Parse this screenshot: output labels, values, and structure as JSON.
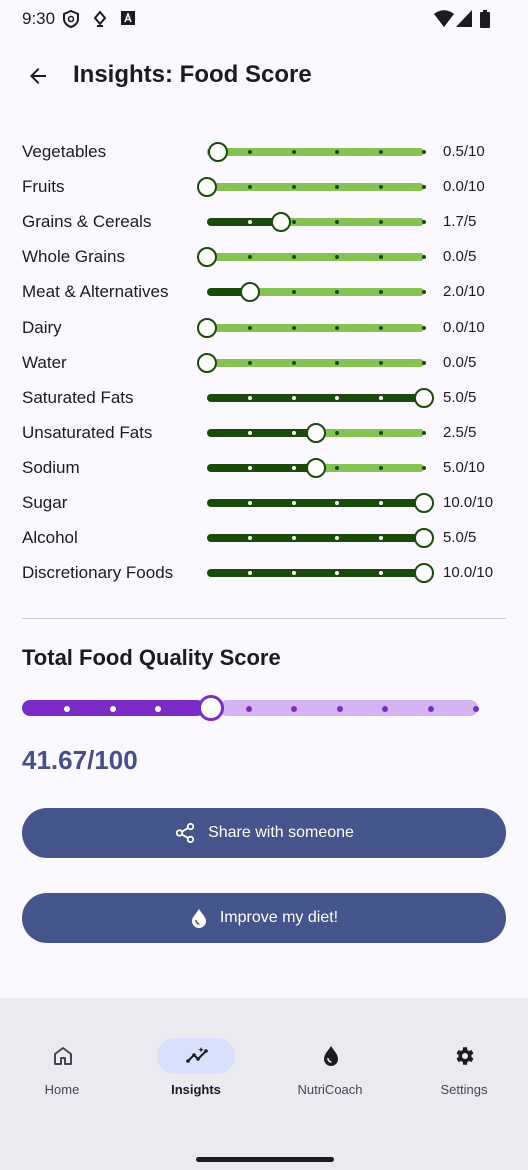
{
  "status_bar": {
    "time": "9:30"
  },
  "header": {
    "title": "Insights: Food Score"
  },
  "categories": [
    {
      "label": "Vegetables",
      "value": 0.5,
      "max": 10,
      "value_text": "0.5/10",
      "fill_style": "inverse"
    },
    {
      "label": "Fruits",
      "value": 0.0,
      "max": 10,
      "value_text": "0.0/10",
      "fill_style": "inverse"
    },
    {
      "label": "Grains & Cereals",
      "value": 1.7,
      "max": 5,
      "value_text": "1.7/5",
      "fill_style": "normal"
    },
    {
      "label": "Whole Grains",
      "value": 0.0,
      "max": 5,
      "value_text": "0.0/5",
      "fill_style": "normal"
    },
    {
      "label": "Meat & Alternatives",
      "value": 2.0,
      "max": 10,
      "value_text": "2.0/10",
      "fill_style": "normal"
    },
    {
      "label": "Dairy",
      "value": 0.0,
      "max": 10,
      "value_text": "0.0/10",
      "fill_style": "normal"
    },
    {
      "label": "Water",
      "value": 0.0,
      "max": 5,
      "value_text": "0.0/5",
      "fill_style": "normal"
    },
    {
      "label": "Saturated Fats",
      "value": 5.0,
      "max": 5,
      "value_text": "5.0/5",
      "fill_style": "normal"
    },
    {
      "label": "Unsaturated Fats",
      "value": 2.5,
      "max": 5,
      "value_text": "2.5/5",
      "fill_style": "normal"
    },
    {
      "label": "Sodium",
      "value": 5.0,
      "max": 10,
      "value_text": "5.0/10",
      "fill_style": "normal"
    },
    {
      "label": "Sugar",
      "value": 10.0,
      "max": 10,
      "value_text": "10.0/10",
      "fill_style": "normal"
    },
    {
      "label": "Alcohol",
      "value": 5.0,
      "max": 5,
      "value_text": "5.0/5",
      "fill_style": "normal"
    },
    {
      "label": "Discretionary Foods",
      "value": 10.0,
      "max": 10,
      "value_text": "10.0/10",
      "fill_style": "normal"
    }
  ],
  "total": {
    "title": "Total Food Quality Score",
    "value": 41.67,
    "max": 100,
    "value_text": "41.67/100"
  },
  "buttons": {
    "share_label": "Share with someone",
    "improve_label": "Improve my diet!"
  },
  "nav": {
    "items": [
      {
        "label": "Home",
        "icon": "home-icon"
      },
      {
        "label": "Insights",
        "icon": "insights-icon"
      },
      {
        "label": "NutriCoach",
        "icon": "nutricoach-icon"
      },
      {
        "label": "Settings",
        "icon": "settings-icon"
      }
    ],
    "active": "Insights"
  },
  "colors": {
    "slider_active": "#1B4A0B",
    "slider_inactive": "#86C253",
    "total_active": "#7B2CC5",
    "total_inactive": "#D3B3F2",
    "button_bg": "#45548A",
    "score_text": "#45508A"
  }
}
